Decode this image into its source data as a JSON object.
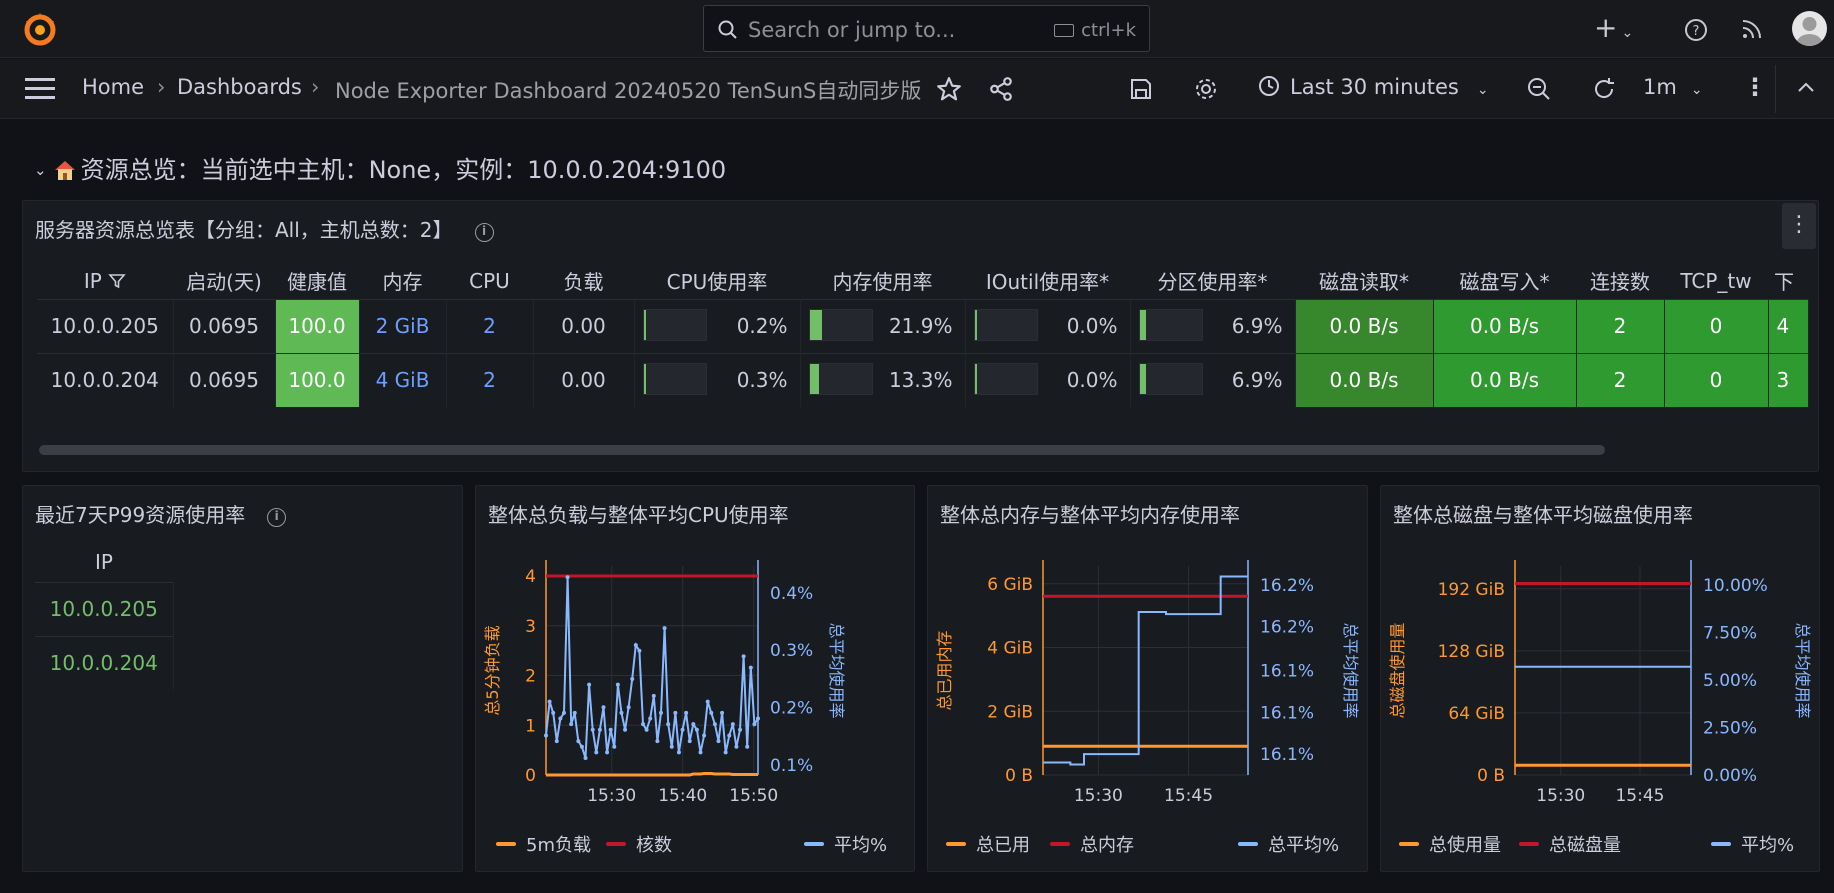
{
  "topbar": {
    "search_placeholder": "Search or jump to...",
    "shortcut": "ctrl+k"
  },
  "breadcrumb": {
    "home": "Home",
    "dashboards": "Dashboards",
    "current": "Node Exporter Dashboard 20240520 TenSunS自动同步版"
  },
  "toolbar": {
    "time_range": "Last 30 minutes",
    "refresh": "1m"
  },
  "row": {
    "title": "资源总览：当前选中主机：None，实例：10.0.0.204:9100",
    "icon": "house-emoji"
  },
  "colors": {
    "orange": "#ff9830",
    "red": "#c4162a",
    "blue": "#8ab8ff",
    "green": "#73bf69",
    "healthGreen": "#5fb955",
    "cellGreen": "#37872d"
  },
  "table_panel": {
    "title": "服务器资源总览表【分组：All，主机总数：2】",
    "headers": [
      "IP",
      "启动(天)",
      "健康值",
      "内存",
      "CPU",
      "负载",
      "CPU使用率",
      "内存使用率",
      "IOutil使用率*",
      "分区使用率*",
      "磁盘读取*",
      "磁盘写入*",
      "连接数",
      "TCP_tw",
      "下"
    ],
    "rows": [
      {
        "ip": "10.0.0.205",
        "uptime": "0.0695",
        "health": "100.0",
        "mem": "2 GiB",
        "cpu": "2",
        "load": "0.00",
        "cpu_use": "0.2%",
        "cpu_frac": 0.002,
        "mem_use": "21.9%",
        "mem_frac": 0.219,
        "io": "0.0%",
        "io_frac": 0.0,
        "part": "6.9%",
        "part_frac": 0.069,
        "read": "0.0 B/s",
        "write": "0.0 B/s",
        "conn": "2",
        "tcptw": "0",
        "next": "4"
      },
      {
        "ip": "10.0.0.204",
        "uptime": "0.0695",
        "health": "100.0",
        "mem": "4 GiB",
        "cpu": "2",
        "load": "0.00",
        "cpu_use": "0.3%",
        "cpu_frac": 0.003,
        "mem_use": "13.3%",
        "mem_frac": 0.133,
        "io": "0.0%",
        "io_frac": 0.0,
        "part": "6.9%",
        "part_frac": 0.069,
        "read": "0.0 B/s",
        "write": "0.0 B/s",
        "conn": "2",
        "tcptw": "0",
        "next": "3"
      }
    ]
  },
  "p99_panel": {
    "title": "最近7天P99资源使用率",
    "header": "IP",
    "rows": [
      "10.0.0.205",
      "10.0.0.204"
    ]
  },
  "chart_data": [
    {
      "type": "line",
      "title": "整体总负载与整体平均CPU使用率",
      "ylabel": "总5分钟负载",
      "y2label": "总平均使用率",
      "x_ticks": [
        "15:30",
        "15:40",
        "15:50"
      ],
      "y_ticks": [
        "0",
        "1",
        "2",
        "3",
        "4"
      ],
      "y2_ticks": [
        "0.1%",
        "0.2%",
        "0.3%",
        "0.4%"
      ],
      "ylim": [
        0,
        4.2
      ],
      "y2lim": [
        0.08,
        0.45
      ],
      "series": [
        {
          "name": "5m负载",
          "axis": "left",
          "color": "#ff9830",
          "values": [
            0,
            0,
            0,
            0,
            0,
            0,
            0,
            0,
            0,
            0,
            0,
            0,
            0,
            0,
            0,
            0,
            0,
            0,
            0,
            0,
            0,
            0,
            0,
            0,
            0,
            0,
            0,
            0,
            0,
            0,
            0,
            0,
            0,
            0,
            0,
            0,
            0,
            0,
            0,
            0,
            0,
            0.02,
            0.02,
            0.02,
            0.03,
            0.03,
            0.03,
            0.02,
            0.02,
            0.02,
            0.02,
            0.02,
            0.01,
            0.01,
            0.01,
            0.01,
            0.01,
            0.01,
            0.01,
            0.01
          ]
        },
        {
          "name": "核数",
          "axis": "left",
          "color": "#c4162a",
          "values": [
            4,
            4
          ]
        },
        {
          "name": "平均%",
          "axis": "right",
          "color": "#8ab8ff",
          "values": [
            0.15,
            0.21,
            0.19,
            0.14,
            0.18,
            0.19,
            0.43,
            0.17,
            0.19,
            0.14,
            0.13,
            0.11,
            0.24,
            0.16,
            0.12,
            0.16,
            0.2,
            0.12,
            0.16,
            0.13,
            0.24,
            0.19,
            0.16,
            0.2,
            0.25,
            0.31,
            0.3,
            0.17,
            0.16,
            0.18,
            0.22,
            0.14,
            0.19,
            0.34,
            0.17,
            0.13,
            0.19,
            0.12,
            0.16,
            0.19,
            0.14,
            0.17,
            0.16,
            0.12,
            0.15,
            0.21,
            0.19,
            0.17,
            0.14,
            0.19,
            0.12,
            0.15,
            0.17,
            0.13,
            0.16,
            0.29,
            0.13,
            0.27,
            0.17,
            0.18
          ]
        }
      ]
    },
    {
      "type": "line",
      "title": "整体总内存与整体平均内存使用率",
      "ylabel": "总已用内存",
      "y2label": "总平均使用率",
      "x_ticks": [
        "15:30",
        "15:45"
      ],
      "y_ticks": [
        "0 B",
        "2 GiB",
        "4 GiB",
        "6 GiB"
      ],
      "y2_ticks": [
        "16.1%",
        "16.1%",
        "16.1%",
        "16.2%",
        "16.2%"
      ],
      "series": [
        {
          "name": "总已用",
          "axis": "left",
          "color": "#ff9830",
          "values": [
            0.9,
            0.9
          ]
        },
        {
          "name": "总内存",
          "axis": "left",
          "color": "#c4162a",
          "values": [
            5.6,
            5.6
          ]
        },
        {
          "name": "总平均%",
          "axis": "right",
          "color": "#8ab8ff",
          "values": [
            0.06,
            0.06,
            0.05,
            0.1,
            0.1,
            0.1,
            0.1,
            0.78,
            0.78,
            0.77,
            0.77,
            0.77,
            0.77,
            0.95,
            0.95,
            0.95
          ]
        }
      ]
    },
    {
      "type": "line",
      "title": "整体总磁盘与整体平均磁盘使用率",
      "ylabel": "总磁盘使用量",
      "y2label": "总平均使用率",
      "x_ticks": [
        "15:30",
        "15:45"
      ],
      "y_ticks": [
        "0 B",
        "64 GiB",
        "128 GiB",
        "192 GiB"
      ],
      "y2_ticks": [
        "0.00%",
        "2.50%",
        "5.00%",
        "7.50%",
        "10.00%"
      ],
      "series": [
        {
          "name": "总使用量",
          "axis": "left",
          "color": "#ff9830",
          "values": [
            10,
            10
          ]
        },
        {
          "name": "总磁盘量",
          "axis": "left",
          "color": "#c4162a",
          "values": [
            197,
            197
          ]
        },
        {
          "name": "平均%",
          "axis": "right",
          "color": "#8ab8ff",
          "values": [
            5.7,
            5.7
          ]
        }
      ]
    }
  ]
}
